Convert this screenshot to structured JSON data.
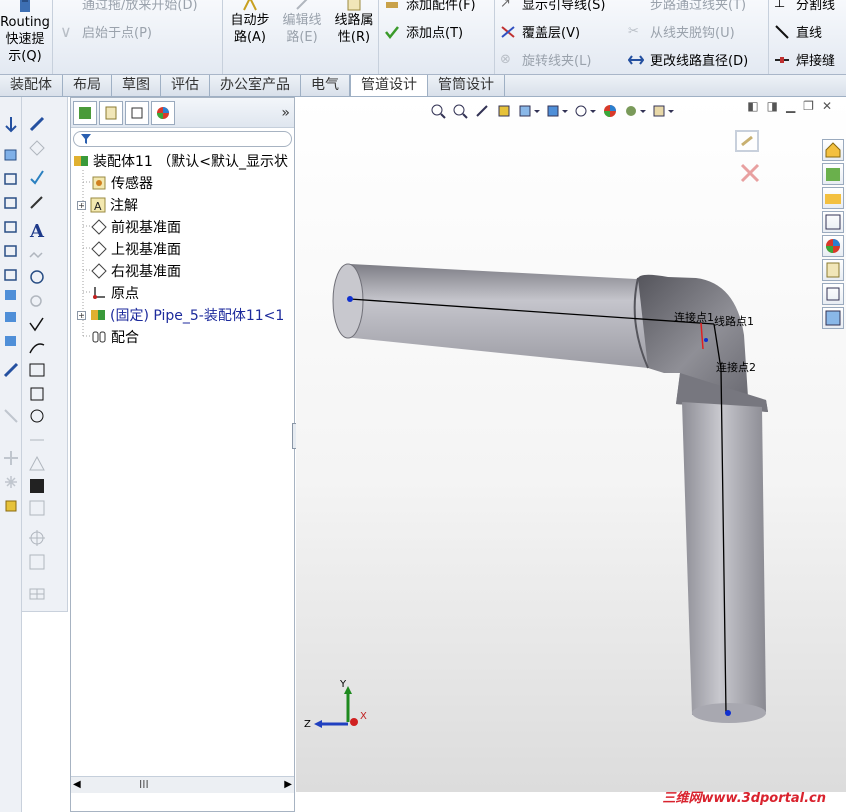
{
  "ribbon": {
    "routing": "Routing\n快速提\n示(Q)",
    "top_cut1": "通过拖/放来开始(D)",
    "start_at_point": "启始于点(P)",
    "auto_route": "自动步\n路(A)",
    "edit_route": "编辑线\n路(E)",
    "route_props": "线路属\n性(R)",
    "add_fitting": "添加配件(F)",
    "add_point": "添加点(T)",
    "show_guides": "显示引导线(S)",
    "cover_layer": "覆盖层(V)",
    "rotate_clip": "旋转线夹(L)",
    "route_through_clip": "步路通过线夹(T)",
    "unclip": "从线夹脱钩(U)",
    "change_diameter": "更改线路直径(D)",
    "split_line": "分割线",
    "line": "直线",
    "weld_gap": "焊接缝"
  },
  "tabs": [
    "装配体",
    "布局",
    "草图",
    "评估",
    "办公室产品",
    "电气",
    "管道设计",
    "管筒设计"
  ],
  "active_tab": "管道设计",
  "tree": {
    "root": "装配体11 （默认<默认_显示状",
    "items": [
      "传感器",
      "注解",
      "前视基准面",
      "上视基准面",
      "右视基准面",
      "原点",
      "(固定) Pipe_5-装配体11<1",
      "配合"
    ],
    "scroll_label": "III"
  },
  "viewport": {
    "labels": {
      "conn1": "连接点1",
      "route_point": "线路点1",
      "conn2": "连接点2"
    },
    "axes": {
      "x": "X",
      "y": "Y",
      "z": "Z"
    }
  },
  "watermark": "三维网www.3dportal.cn",
  "colors": {
    "pipe": "#b9b9c0",
    "fitting": "#8a8a92",
    "axis_x": "#d02020",
    "axis_y": "#1e8a1e",
    "axis_z": "#2040c0"
  }
}
